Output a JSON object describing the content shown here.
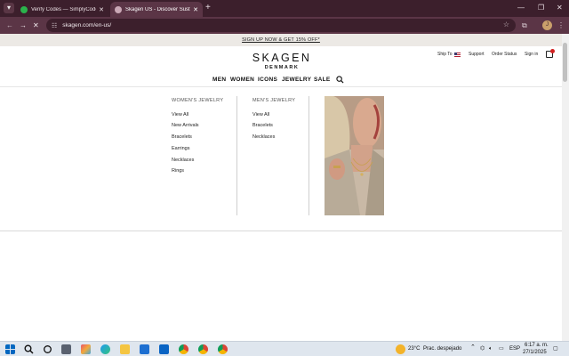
{
  "browser": {
    "tabs": [
      {
        "title": "Verify Codes — SimplyCodes",
        "active": false
      },
      {
        "title": "Skagen US - Discover Sustainal",
        "active": true
      }
    ],
    "url": "skagen.com/en-us/",
    "colors": {
      "tabstrip": "#3c1f2c",
      "toolbar": "#5b3546"
    }
  },
  "promo": {
    "text": "SIGN UP NOW & GET 15% OFF*"
  },
  "header": {
    "brand": "SKAGEN",
    "brand_sub": "DENMARK",
    "utility": {
      "ship_to": "Ship To",
      "support": "Support",
      "order_status": "Order Status",
      "sign_in": "Sign in"
    }
  },
  "nav": {
    "items": [
      "MEN",
      "WOMEN",
      "ICONS",
      "JEWELRY",
      "SALE"
    ]
  },
  "megamenu": {
    "columns": [
      {
        "title": "WOMEN'S JEWELRY",
        "links": [
          "View All",
          "New Arrivals",
          "Bracelets",
          "Earrings",
          "Necklaces",
          "Rings"
        ]
      },
      {
        "title": "MEN'S JEWELRY",
        "links": [
          "View All",
          "Bracelets",
          "Necklaces"
        ]
      }
    ]
  },
  "taskbar": {
    "weather": {
      "temp": "23°C",
      "condition": "Prac. despejado"
    },
    "language": "ESP",
    "time": "6:17 a. m.",
    "date": "27/1/2025"
  }
}
